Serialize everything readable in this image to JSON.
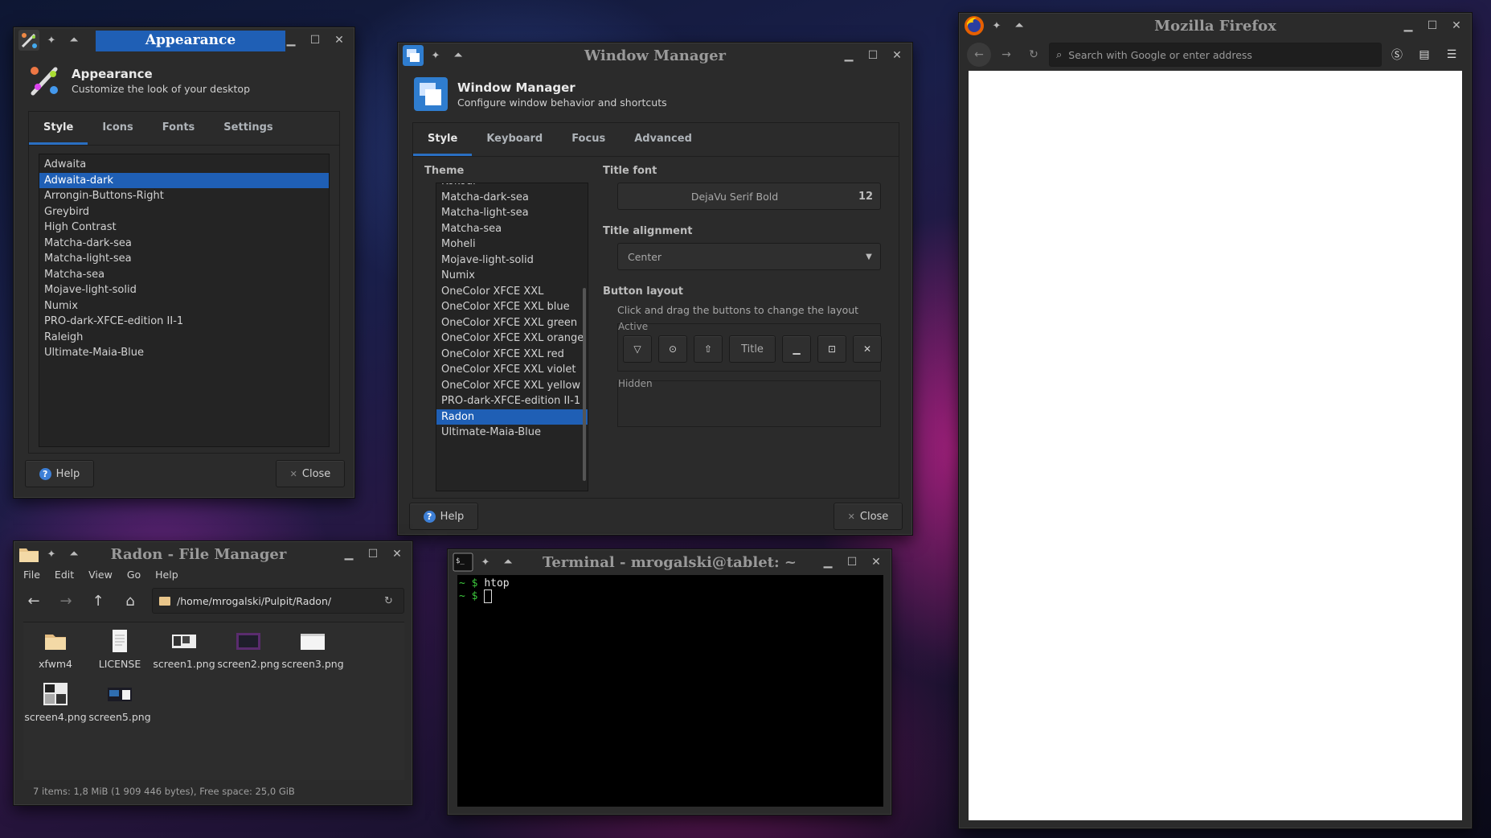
{
  "appearance": {
    "title": "Appearance",
    "header_title": "Appearance",
    "header_subtitle": "Customize the look of your desktop",
    "tabs": [
      "Style",
      "Icons",
      "Fonts",
      "Settings"
    ],
    "themes": [
      "Adwaita",
      "Adwaita-dark",
      "Arrongin-Buttons-Right",
      "Greybird",
      "High Contrast",
      "Matcha-dark-sea",
      "Matcha-light-sea",
      "Matcha-sea",
      "Mojave-light-solid",
      "Numix",
      "PRO-dark-XFCE-edition II-1",
      "Raleigh",
      "Ultimate-Maia-Blue"
    ],
    "selected_theme": "Adwaita-dark",
    "help_label": "Help",
    "close_label": "Close"
  },
  "window_manager": {
    "title": "Window Manager",
    "header_title": "Window Manager",
    "header_subtitle": "Configure window behavior and shortcuts",
    "tabs": [
      "Style",
      "Keyboard",
      "Focus",
      "Advanced"
    ],
    "theme_label": "Theme",
    "themes": [
      "Kokodi",
      "Matcha-dark-sea",
      "Matcha-light-sea",
      "Matcha-sea",
      "Moheli",
      "Mojave-light-solid",
      "Numix",
      "OneColor XFCE XXL",
      "OneColor XFCE XXL blue",
      "OneColor XFCE XXL green",
      "OneColor XFCE XXL orange",
      "OneColor XFCE XXL red",
      "OneColor XFCE XXL violet",
      "OneColor XFCE XXL yellow",
      "PRO-dark-XFCE-edition II-1",
      "Radon",
      "Ultimate-Maia-Blue"
    ],
    "selected_theme": "Radon",
    "title_font_label": "Title font",
    "title_font_value": "DejaVu Serif Bold",
    "title_font_size": "12",
    "title_alignment_label": "Title alignment",
    "title_alignment_value": "Center",
    "button_layout_label": "Button layout",
    "button_layout_hint": "Click and drag the buttons to change the layout",
    "active_label": "Active",
    "title_button_label": "Title",
    "hidden_label": "Hidden",
    "help_label": "Help",
    "close_label": "Close"
  },
  "firefox": {
    "title": "Mozilla Firefox",
    "search_placeholder": "Search with Google or enter address"
  },
  "file_manager": {
    "title": "Radon - File Manager",
    "menu": [
      "File",
      "Edit",
      "View",
      "Go",
      "Help"
    ],
    "path": "/home/mrogalski/Pulpit/Radon/",
    "files": [
      {
        "name": "xfwm4",
        "icon": "folder-icon"
      },
      {
        "name": "LICENSE",
        "icon": "text-file-icon"
      },
      {
        "name": "screen1.png",
        "icon": "image-file-icon"
      },
      {
        "name": "screen2.png",
        "icon": "image-file-icon"
      },
      {
        "name": "screen3.png",
        "icon": "image-file-icon"
      },
      {
        "name": "screen4.png",
        "icon": "image-file-icon"
      },
      {
        "name": "screen5.png",
        "icon": "image-file-icon"
      }
    ],
    "status": "7 items: 1,8 MiB (1 909 446 bytes), Free space: 25,0 GiB"
  },
  "terminal": {
    "title": "Terminal - mrogalski@tablet: ~",
    "lines": [
      {
        "prompt": "~ $ ",
        "command": "htop"
      },
      {
        "prompt": "~ $ ",
        "command": ""
      }
    ]
  },
  "colors": {
    "accent": "#1f5fb5",
    "window_bg": "#2b2b2b",
    "prompt_green": "#3cc83c"
  }
}
